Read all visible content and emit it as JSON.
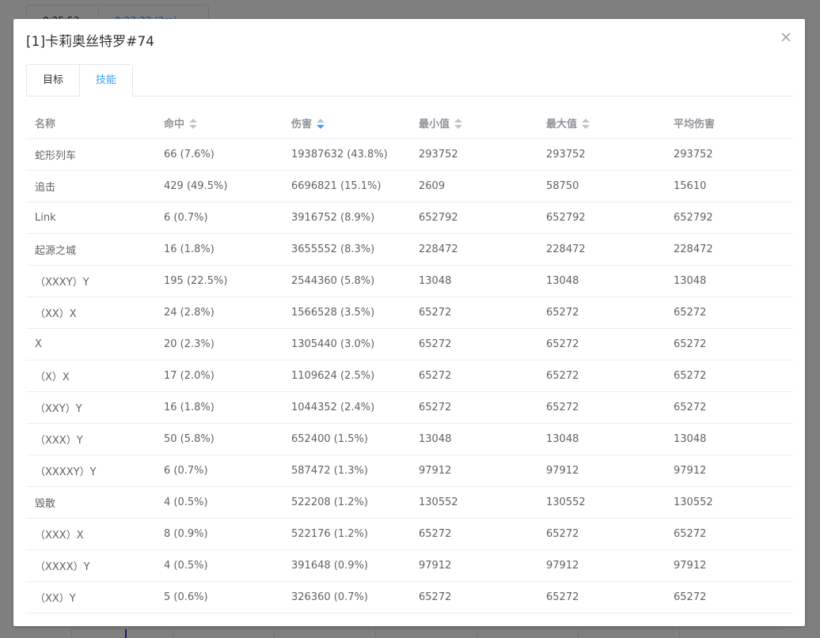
{
  "background": {
    "time_start": "0:25:53",
    "time_end": "0:27:33 (2m)"
  },
  "dialog": {
    "title": "[1]卡莉奥丝特罗#74"
  },
  "tabs": [
    {
      "label": "目标",
      "active": false
    },
    {
      "label": "技能",
      "active": true
    }
  ],
  "table": {
    "columns": [
      {
        "label": "名称",
        "sortable": false
      },
      {
        "label": "命中",
        "sortable": true
      },
      {
        "label": "伤害",
        "sortable": true,
        "sort": "descending"
      },
      {
        "label": "最小值",
        "sortable": true
      },
      {
        "label": "最大值",
        "sortable": true
      },
      {
        "label": "平均伤害",
        "sortable": false
      }
    ],
    "rows": [
      [
        "蛇形列车",
        "66 (7.6%)",
        "19387632 (43.8%)",
        "293752",
        "293752",
        "293752"
      ],
      [
        "追击",
        "429 (49.5%)",
        "6696821 (15.1%)",
        "2609",
        "58750",
        "15610"
      ],
      [
        "Link",
        "6 (0.7%)",
        "3916752 (8.9%)",
        "652792",
        "652792",
        "652792"
      ],
      [
        "起源之城",
        "16 (1.8%)",
        "3655552 (8.3%)",
        "228472",
        "228472",
        "228472"
      ],
      [
        "（XXXY）Y",
        "195 (22.5%)",
        "2544360 (5.8%)",
        "13048",
        "13048",
        "13048"
      ],
      [
        "（XX）X",
        "24 (2.8%)",
        "1566528 (3.5%)",
        "65272",
        "65272",
        "65272"
      ],
      [
        "X",
        "20 (2.3%)",
        "1305440 (3.0%)",
        "65272",
        "65272",
        "65272"
      ],
      [
        "（X）X",
        "17 (2.0%)",
        "1109624 (2.5%)",
        "65272",
        "65272",
        "65272"
      ],
      [
        "（XXY）Y",
        "16 (1.8%)",
        "1044352 (2.4%)",
        "65272",
        "65272",
        "65272"
      ],
      [
        "（XXX）Y",
        "50 (5.8%)",
        "652400 (1.5%)",
        "13048",
        "13048",
        "13048"
      ],
      [
        "（XXXXY）Y",
        "6 (0.7%)",
        "587472 (1.3%)",
        "97912",
        "97912",
        "97912"
      ],
      [
        "毁散",
        "4 (0.5%)",
        "522208 (1.2%)",
        "130552",
        "130552",
        "130552"
      ],
      [
        "（XXX）X",
        "8 (0.9%)",
        "522176 (1.2%)",
        "65272",
        "65272",
        "65272"
      ],
      [
        "（XXXX）Y",
        "4 (0.5%)",
        "391648 (0.9%)",
        "97912",
        "97912",
        "97912"
      ],
      [
        "（XX）Y",
        "5 (0.6%)",
        "326360 (0.7%)",
        "65272",
        "65272",
        "65272"
      ]
    ]
  },
  "colors": {
    "accent": "#409eff",
    "text": "#606266",
    "header_text": "#909399",
    "border": "#ebeef5",
    "mask": "rgba(0,0,0,0.5)"
  },
  "icons": {
    "close": "close-icon",
    "sort": "sort-caret-icon"
  }
}
